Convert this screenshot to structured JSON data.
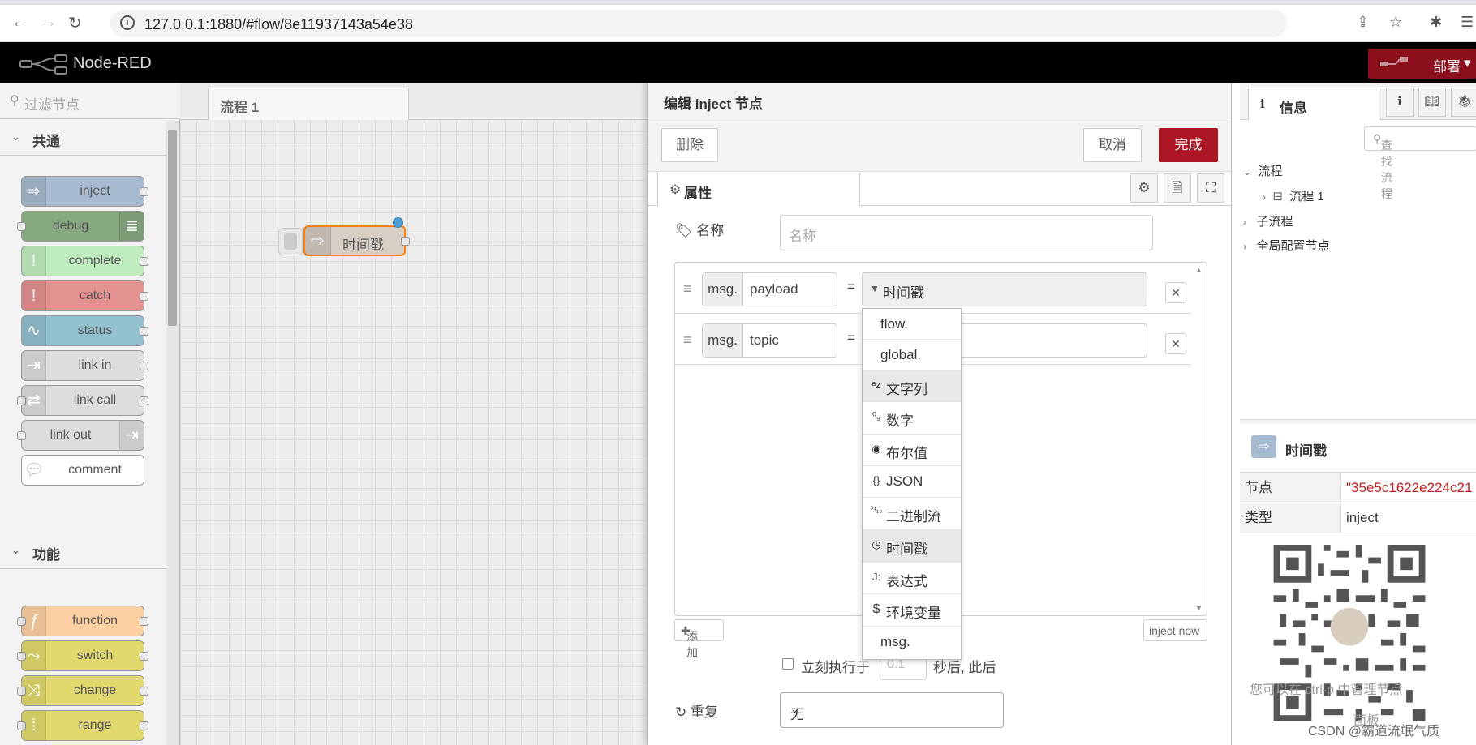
{
  "browser": {
    "url": "127.0.0.1:1880/#flow/8e11937143a54e38",
    "back_icon": "arrow-left-icon",
    "forward_icon": "arrow-right-icon",
    "reload_icon": "reload-icon"
  },
  "header": {
    "title": "Node-RED",
    "deploy_label": "部署"
  },
  "palette": {
    "search_placeholder": "过滤节点",
    "categories": [
      {
        "label": "共通"
      },
      {
        "label": "功能"
      }
    ],
    "common_nodes": [
      {
        "label": "inject",
        "color": "#a6bbcf"
      },
      {
        "label": "debug",
        "color": "#87a980"
      },
      {
        "label": "complete",
        "color": "#c0edc0"
      },
      {
        "label": "catch",
        "color": "#e49191"
      },
      {
        "label": "status",
        "color": "#94c1d0"
      },
      {
        "label": "link in",
        "color": "#dddddd"
      },
      {
        "label": "link call",
        "color": "#dddddd"
      },
      {
        "label": "link out",
        "color": "#dddddd"
      },
      {
        "label": "comment",
        "color": "#ffffff"
      }
    ],
    "function_nodes": [
      {
        "label": "function",
        "color": "#fdd0a2"
      },
      {
        "label": "switch",
        "color": "#e2d96e"
      },
      {
        "label": "change",
        "color": "#e2d96e"
      },
      {
        "label": "range",
        "color": "#e2d96e"
      }
    ]
  },
  "workspace": {
    "tab_label": "流程 1",
    "node_label": "时间戳"
  },
  "editor": {
    "title": "编辑 inject 节点",
    "delete_label": "删除",
    "cancel_label": "取消",
    "done_label": "完成",
    "tab_properties": "属性",
    "name_label": "名称",
    "name_placeholder": "名称",
    "rows": [
      {
        "prefix": "msg.",
        "property": "payload",
        "equals": "=",
        "type_value": "时间戳"
      },
      {
        "prefix": "msg.",
        "property": "topic",
        "equals": "=",
        "type_value": ""
      }
    ],
    "add_label": "添加",
    "inject_now_label": "inject now",
    "once_label": "立刻执行于",
    "once_value": "0.1",
    "once_after": "秒后, 此后",
    "repeat_label": "重复",
    "repeat_value": "无",
    "type_menu": [
      {
        "icon": "",
        "label": "flow."
      },
      {
        "icon": "",
        "label": "global."
      },
      {
        "icon": "ᵃz",
        "label": "文字列",
        "highlight": true
      },
      {
        "icon": "⁰₉",
        "label": "数字"
      },
      {
        "icon": "◉",
        "label": "布尔值"
      },
      {
        "icon": "{}",
        "label": "JSON"
      },
      {
        "icon": "⁰¹₁₀",
        "label": "二进制流"
      },
      {
        "icon": "◷",
        "label": "时间戳",
        "highlight": true
      },
      {
        "icon": "J:",
        "label": "表达式"
      },
      {
        "icon": "$",
        "label": "环境变量"
      },
      {
        "icon": "",
        "label": "msg."
      }
    ]
  },
  "sidebar": {
    "tab_info": "信息",
    "search_placeholder": "查找流程",
    "tree": {
      "flows": "流程",
      "flow1": "流程 1",
      "subflows": "子流程",
      "global_config": "全局配置节点"
    },
    "node_title": "时间戳",
    "node_key": "节点",
    "node_value": "\"35e5c1622e224c21",
    "type_key": "类型",
    "type_value": "inject",
    "help_text": "您可以在 ctrl-p 中管理节点",
    "help_bottom": "面板"
  },
  "watermark": "CSDN @霸道流氓气质"
}
